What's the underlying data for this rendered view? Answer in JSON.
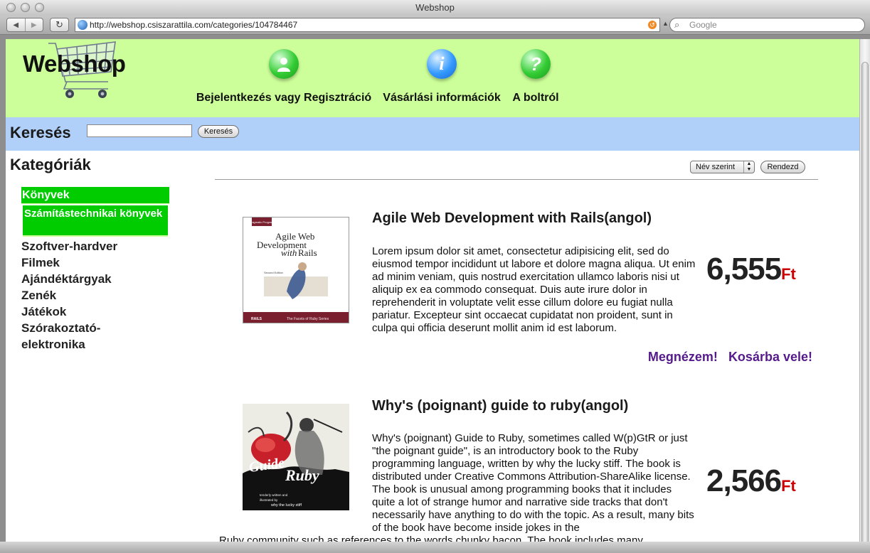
{
  "window": {
    "title": "Webshop"
  },
  "browser": {
    "url": "http://webshop.csiszarattila.com/categories/104784467",
    "search_placeholder": "Google"
  },
  "header": {
    "logo": "Webshop",
    "nav": [
      {
        "label": "Bejelentkezés vagy Regisztráció",
        "icon": "user-icon",
        "color": "#33cc33"
      },
      {
        "label": "Vásárlási információk",
        "icon": "info-icon",
        "color": "#3399ff"
      },
      {
        "label": "A boltról",
        "icon": "question-icon",
        "color": "#33cc33"
      }
    ]
  },
  "search": {
    "label": "Keresés",
    "button": "Keresés",
    "value": ""
  },
  "sidebar": {
    "title": "Kategóriák",
    "active": "Könyvek",
    "active_sub": "Számítástechnikai könyvek",
    "items": [
      "Szoftver-hardver",
      "Filmek",
      "Ajándéktárgyak",
      "Zenék",
      "Játékok",
      "Szórakoztató-elektronika"
    ]
  },
  "sort": {
    "selected": "Név szerint",
    "button": "Rendezd"
  },
  "products": [
    {
      "title": "Agile Web Development with Rails(angol)",
      "description": "Lorem ipsum dolor sit amet, consectetur adipisicing elit, sed do eiusmod tempor incididunt ut labore et dolore magna aliqua. Ut enim ad minim veniam, quis nostrud exercitation ullamco laboris nisi ut aliquip ex ea commodo consequat. Duis aute irure dolor in reprehenderit in voluptate velit esse cillum dolore eu fugiat nulla pariatur. Excepteur sint occaecat cupidatat non proident, sunt in culpa qui officia deserunt mollit anim id est laborum.",
      "price": "6,555",
      "currency": "Ft",
      "view_label": "Megnézem!",
      "cart_label": "Kosárba vele!",
      "cover": {
        "text_top": "Agile Web Development with Rails",
        "edition": "Second Edition",
        "footer": "The Facets of Ruby Series",
        "publisher": "The Pragmatic Programmers"
      }
    },
    {
      "title": "Why's (poignant) guide to ruby(angol)",
      "description": "Why's (poignant) Guide to Ruby, sometimes called W(p)GtR or just \"the poignant guide\", is an introductory book to the Ruby programming language, written by why the lucky stiff. The book is distributed under Creative Commons Attribution-ShareAlike license. The book is unusual among programming books that it includes quite a lot of strange humor and narrative side tracks that don't necessarily have anything to do with the topic. As a result, many bits of the book have become inside jokes in the",
      "description_cont": "Ruby community such as references to the words chunky bacon. The book includes many",
      "price": "2,566",
      "currency": "Ft",
      "cover": {
        "text_top": "Guide to Ruby",
        "credit": "tenderly written and illustrated by why the lucky stiff"
      }
    }
  ]
}
